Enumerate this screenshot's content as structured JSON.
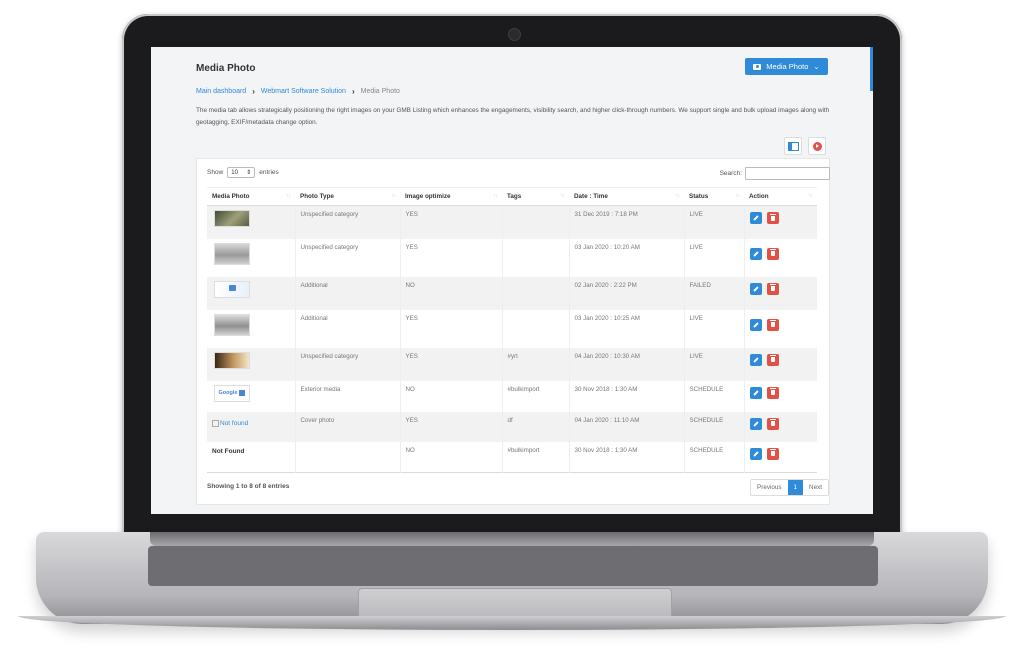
{
  "page": {
    "title": "Media Photo",
    "top_button": "Media Photo",
    "breadcrumb": [
      "Main dashboard",
      "Webmart Software Solution",
      "Media Photo"
    ],
    "description": "The media tab allows strategically positioning the right images on your GMB Listing which enhances the engagements, visibility search, and higher click-through numbers. We support single and bulk upload images along with geotagging, EXIF/metadata change option."
  },
  "table_controls": {
    "show_label": "Show",
    "entries_value": "10",
    "entries_label": "entries",
    "search_label": "Search:"
  },
  "columns": [
    "Media Photo",
    "Photo Type",
    "Image optimize",
    "Tags",
    "Date : Time",
    "Status",
    "Action"
  ],
  "rows": [
    {
      "photo": "thumb",
      "type": "Unspecified category",
      "optimize": "YES",
      "tags": "",
      "datetime": "31 Dec 2019 : 7:18 PM",
      "status": "LIVE"
    },
    {
      "photo": "thumb",
      "type": "Unspecified category",
      "optimize": "YES",
      "tags": "",
      "datetime": "03 Jan 2020 : 10:20 AM",
      "status": "LIVE"
    },
    {
      "photo": "thumb",
      "type": "Additional",
      "optimize": "NO",
      "tags": "",
      "datetime": "02 Jan 2020 : 2:22 PM",
      "status": "FAILED"
    },
    {
      "photo": "thumb",
      "type": "Additional",
      "optimize": "YES",
      "tags": "",
      "datetime": "03 Jan 2020 : 10:25 AM",
      "status": "LIVE"
    },
    {
      "photo": "thumb",
      "type": "Unspecified category",
      "optimize": "YES",
      "tags": "#yrt",
      "datetime": "04 Jan 2020 : 10:30 AM",
      "status": "LIVE"
    },
    {
      "photo": "thumb",
      "type": "Exterior media",
      "optimize": "NO",
      "tags": "#bulkimport",
      "datetime": "30 Nov 2018 : 1:30 AM",
      "status": "SCHEDULE"
    },
    {
      "photo": "Not found",
      "type": "Cover photo",
      "optimize": "YES",
      "tags": "df",
      "datetime": "04 Jan 2020 : 11:10 AM",
      "status": "SCHEDULE"
    },
    {
      "photo": "Not Found",
      "type": "",
      "optimize": "NO",
      "tags": "#bulkimport",
      "datetime": "30 Nov 2018 : 1:30 AM",
      "status": "SCHEDULE"
    }
  ],
  "thumb6_text": "Google",
  "footer": {
    "info": "Showing 1 to 8 of 8 entries",
    "previous": "Previous",
    "page": "1",
    "next": "Next"
  },
  "colors": {
    "accent": "#2f8ad8",
    "danger": "#e05246"
  },
  "icons": [
    "camera-icon",
    "chevron-down-icon",
    "sidebar-toggle-icon",
    "play-icon",
    "pencil-icon",
    "trash-icon",
    "sort-icon"
  ]
}
